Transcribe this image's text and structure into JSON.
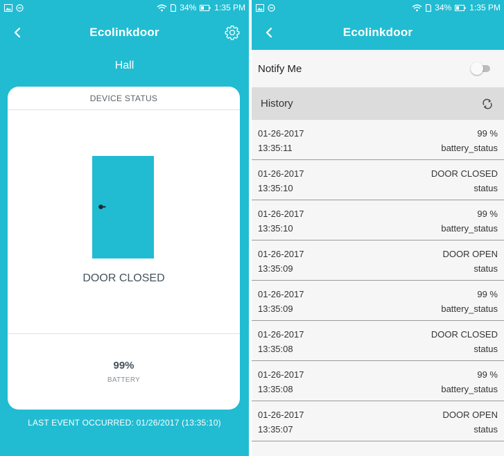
{
  "status_bar": {
    "battery": "34%",
    "time": "1:35 PM"
  },
  "colors": {
    "accent": "#21bcd2",
    "card": "#ffffff",
    "history_header": "#dcdcdc"
  },
  "left_screen": {
    "app_title": "Ecolinkdoor",
    "room_name": "Hall",
    "card_title": "DEVICE STATUS",
    "door_state": "DOOR CLOSED",
    "battery_value": "99%",
    "battery_label": "BATTERY",
    "last_event": "LAST EVENT OCCURRED: 01/26/2017 (13:35:10)"
  },
  "right_screen": {
    "app_title": "Ecolinkdoor",
    "notify_label": "Notify Me",
    "notify_enabled": false,
    "history_label": "History",
    "history": [
      {
        "date": "01-26-2017",
        "time": "13:35:11",
        "value": "99 %",
        "type": "battery_status"
      },
      {
        "date": "01-26-2017",
        "time": "13:35:10",
        "value": "DOOR CLOSED",
        "type": "status"
      },
      {
        "date": "01-26-2017",
        "time": "13:35:10",
        "value": "99 %",
        "type": "battery_status"
      },
      {
        "date": "01-26-2017",
        "time": "13:35:09",
        "value": "DOOR OPEN",
        "type": "status"
      },
      {
        "date": "01-26-2017",
        "time": "13:35:09",
        "value": "99 %",
        "type": "battery_status"
      },
      {
        "date": "01-26-2017",
        "time": "13:35:08",
        "value": "DOOR CLOSED",
        "type": "status"
      },
      {
        "date": "01-26-2017",
        "time": "13:35:08",
        "value": "99 %",
        "type": "battery_status"
      },
      {
        "date": "01-26-2017",
        "time": "13:35:07",
        "value": "DOOR OPEN",
        "type": "status"
      }
    ]
  }
}
